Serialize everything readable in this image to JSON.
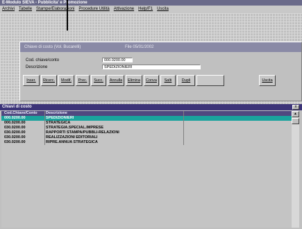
{
  "app": {
    "title": "E-Modulo SIEVA - Pubblicita' e Promozione"
  },
  "menu": [
    "Archivi",
    "Tabelle",
    "Stampe/Elaborazioni",
    "Procedure Utilità",
    "Attivazione",
    "Help/F1",
    "Uscita"
  ],
  "form": {
    "title": "Chiave di costo (Vol. Bucarelli)",
    "subtitle": "File 05/01/2002",
    "fields": [
      {
        "label": "Cod. chiave/conto",
        "value": "000.0200.00"
      },
      {
        "label": "Descrizione",
        "value": "SPEDIZIONIERI"
      }
    ],
    "buttons": [
      "Inser.",
      "Ricerc.",
      "Modif.",
      "Prec.",
      "Succ.",
      "Annulla",
      "Elimina",
      "Conva",
      "Salti",
      "Dupli",
      "",
      "Uscita"
    ]
  },
  "grid": {
    "title": "Chiavi di costo",
    "close_label": "x",
    "columns": [
      "Cod.Chiave/Conto",
      "Descrizione"
    ],
    "rows": [
      {
        "code": "000.0200.00",
        "desc": "SPEDIZIONIERI"
      },
      {
        "code": "000.0200.00",
        "desc": "STRATEGICA"
      },
      {
        "code": "030.0200.00",
        "desc": "STRATEGIA.SPECIAL.IMPRESE"
      },
      {
        "code": "030.0200.00",
        "desc": "RAPPORTI STAMPA/PUBBLI-RELAZIONI"
      },
      {
        "code": "030.0200.00",
        "desc": "REALIZZAZIONI EDITORIALI"
      },
      {
        "code": "030.0200.00",
        "desc": "RIPRE.ANNUA STRATEGICA"
      }
    ],
    "selected_row": 0
  },
  "colors": {
    "selection": "#1aa39d",
    "title_bar": "#3c3478"
  }
}
